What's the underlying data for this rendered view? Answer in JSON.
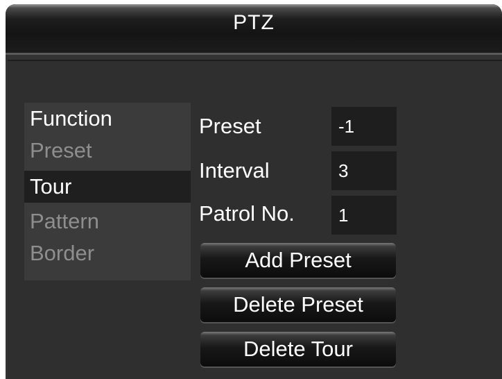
{
  "window": {
    "title": "PTZ"
  },
  "menu": {
    "header": "Function",
    "items": [
      {
        "label": "Preset"
      },
      {
        "label": "Tour",
        "selected": true
      },
      {
        "label": "Pattern"
      },
      {
        "label": "Border"
      }
    ]
  },
  "fields": {
    "preset": {
      "label": "Preset",
      "value": "-1"
    },
    "interval": {
      "label": "Interval",
      "value": "3"
    },
    "patrol": {
      "label": "Patrol No.",
      "value": "1"
    }
  },
  "buttons": {
    "add_preset": "Add Preset",
    "delete_preset": "Delete Preset",
    "delete_tour": "Delete Tour"
  },
  "colors": {
    "background": "#333333",
    "selected": "#1f1f1f",
    "text": "#ffffff",
    "inactive_text": "#8e8e8e"
  }
}
